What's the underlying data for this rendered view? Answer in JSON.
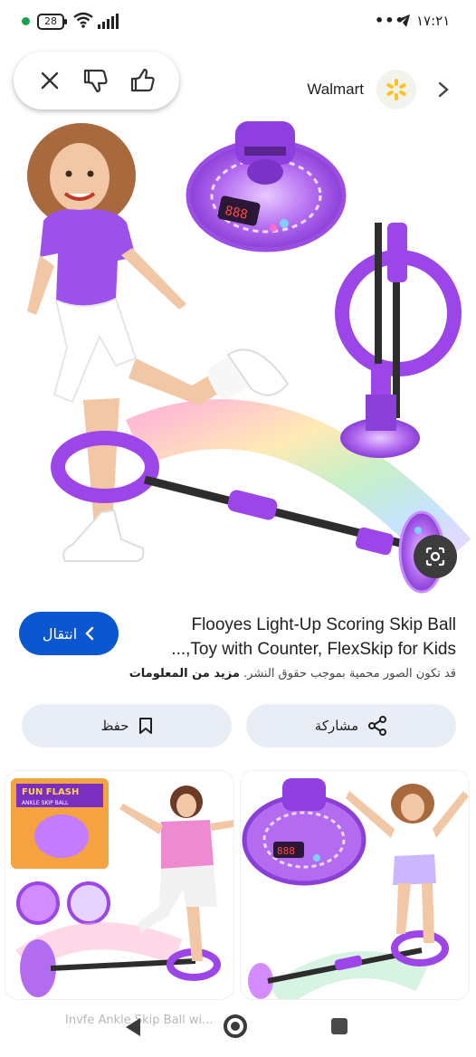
{
  "status_bar": {
    "battery": "28",
    "time": "١٧:٢١",
    "dots": "•••"
  },
  "feedback": {
    "icons": [
      "close-icon",
      "thumbs-down-icon",
      "thumbs-up-icon"
    ]
  },
  "source": {
    "name": "Walmart",
    "logo_icon": "walmart-spark-icon",
    "chevron_icon": "chevron-right-icon"
  },
  "result": {
    "title_line1": "Flooyes Light-Up Scoring Skip Ball",
    "title_line2": "Toy with Counter, FlexSkip for Kids,...",
    "notice_text": "قد تكون الصور محمية بموجب حقوق النشر.",
    "notice_link": "مزيد من المعلومات",
    "visit_label": "انتقال",
    "save_label": "حفظ",
    "share_label": "مشاركة"
  },
  "related": {
    "left_badge_line1": "FUN FLASH",
    "left_badge_line2": "ANKLE SKIP BALL",
    "caption": "Invfe Ankle Skip Ball wi..."
  },
  "colors": {
    "accent_blue": "#0b57d0",
    "chip_bg": "#e9eef6",
    "toy_purple": "#9c45e8",
    "walmart_yellow": "#ffc220"
  }
}
